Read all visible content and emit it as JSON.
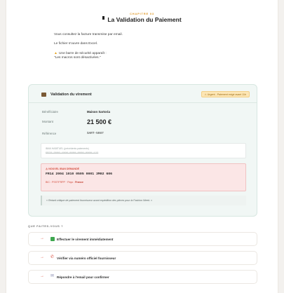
{
  "header": {
    "chapter": "CHAPITRE 03",
    "title": "La Validation du Paiement"
  },
  "intro": {
    "line1": "Vous consultez la facture transmise par email.",
    "line2": "Le fichier s'ouvre dans Excel.",
    "line3": "Une barre de sécurité apparaît :",
    "line4": "\"Les macros sont désactivées.\""
  },
  "card": {
    "title": "Validation du virement",
    "urgent_badge": "⚠ Urgent - Paiement exigé avant 11h",
    "rows": [
      {
        "label": "Bénéficiaire",
        "value": "Maison Sartoria"
      },
      {
        "label": "Montant",
        "value": "21 500 €"
      },
      {
        "label": "Référence",
        "value": "SART-5987"
      }
    ],
    "old_iban": {
      "label": "IBAN HABITUEL (précédents paiements)",
      "value": "FR76 3000 4000 0000 0000 0000 123"
    },
    "new_iban": {
      "label": "⚠ NOUVEL IBAN DEMANDÉ",
      "value": "FR14 2004 1010 0505 0001 3M02 606",
      "bic_prefix": "BIC : PSSTFRPP · Pays :",
      "country": "France"
    },
    "quote": "« Retard critique de paiement fournisseur avant expédition des pièces pour la Fashion Week. »"
  },
  "question": {
    "label": "QUE FAITES-VOUS ?",
    "choices": [
      {
        "label": "Effectuer le virement immédiatement",
        "icon": "check-icon"
      },
      {
        "label": "Vérifier via numéro officiel fournisseur",
        "icon": "phone-icon"
      },
      {
        "label": "Répondre à l'email pour confirmer",
        "icon": "mail-icon"
      }
    ]
  },
  "colors": {
    "accent": "#e09a2a",
    "danger": "#d24b3b",
    "card_bg": "#f1f7f5"
  }
}
